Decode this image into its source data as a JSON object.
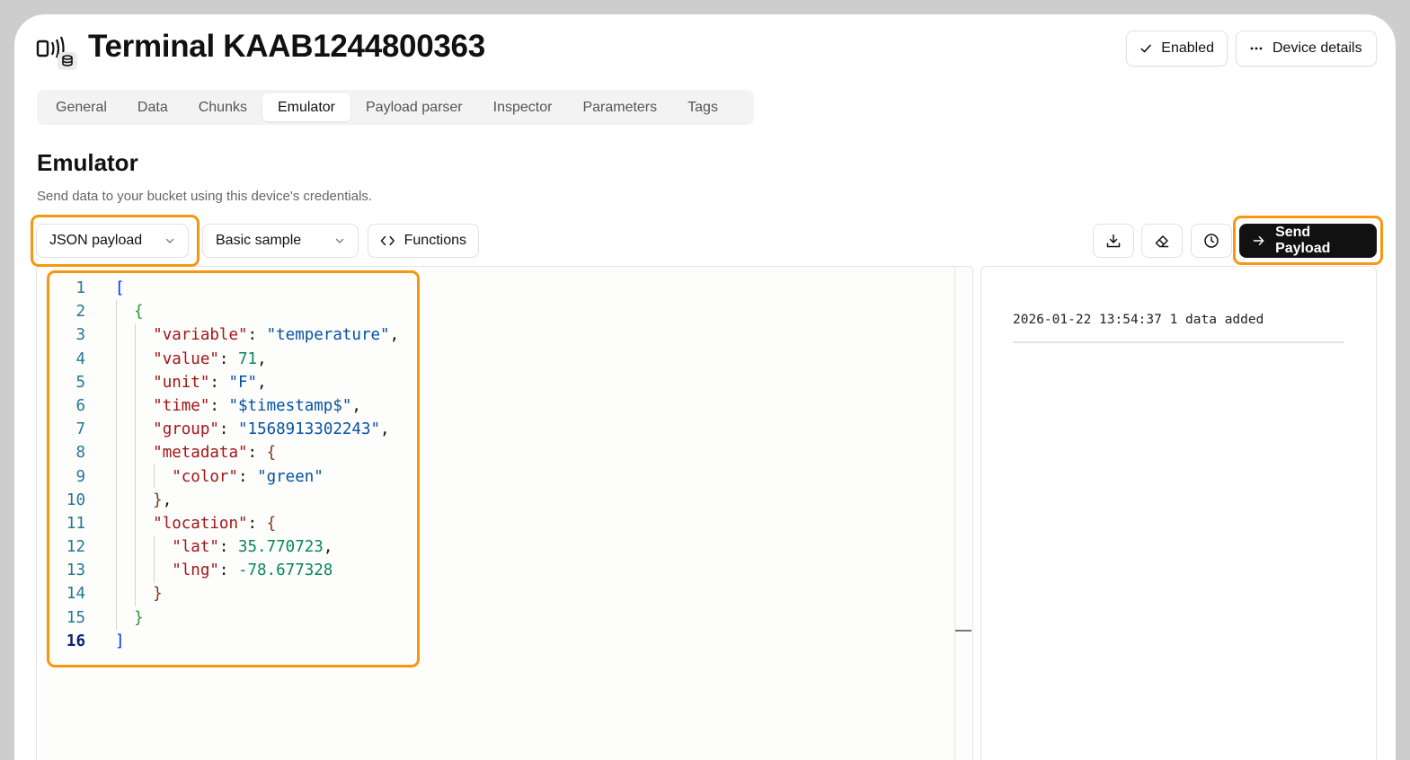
{
  "header": {
    "title": "Terminal KAAB1244800363",
    "enabled_label": "Enabled",
    "details_label": "Device details"
  },
  "tabs": [
    {
      "label": "General"
    },
    {
      "label": "Data"
    },
    {
      "label": "Chunks"
    },
    {
      "label": "Emulator",
      "active": true
    },
    {
      "label": "Payload parser"
    },
    {
      "label": "Inspector"
    },
    {
      "label": "Parameters"
    },
    {
      "label": "Tags"
    }
  ],
  "section": {
    "title": "Emulator",
    "subtitle": "Send data to your bucket using this device's credentials."
  },
  "toolbar": {
    "format_select": "JSON payload",
    "sample_select": "Basic sample",
    "functions_label": "Functions",
    "send_label": "Send Payload",
    "icons": [
      "download-icon",
      "eraser-icon",
      "clock-icon",
      "arrow-right-icon"
    ]
  },
  "editor": {
    "line_numbers": [
      "1",
      "2",
      "3",
      "4",
      "5",
      "6",
      "7",
      "8",
      "9",
      "10",
      "11",
      "12",
      "13",
      "14",
      "15",
      "16"
    ],
    "values": {
      "variable": "\"temperature\"",
      "value": "71",
      "unit": "\"F\"",
      "time": "\"$timestamp$\"",
      "group": "\"1568913302243\"",
      "color": "\"green\"",
      "lat": "35.770723",
      "lng": "-78.677328"
    },
    "keys": {
      "variable": "\"variable\"",
      "value": "\"value\"",
      "unit": "\"unit\"",
      "time": "\"time\"",
      "group": "\"group\"",
      "metadata": "\"metadata\"",
      "color": "\"color\"",
      "location": "\"location\"",
      "lat": "\"lat\"",
      "lng": "\"lng\""
    }
  },
  "output": {
    "log": "2026-01-22 13:54:37 1 data added"
  },
  "colors": {
    "highlight": "#f7970f",
    "send_button": "#111111",
    "json_key": "#a31515",
    "json_string": "#0451a5",
    "json_number": "#098658"
  }
}
